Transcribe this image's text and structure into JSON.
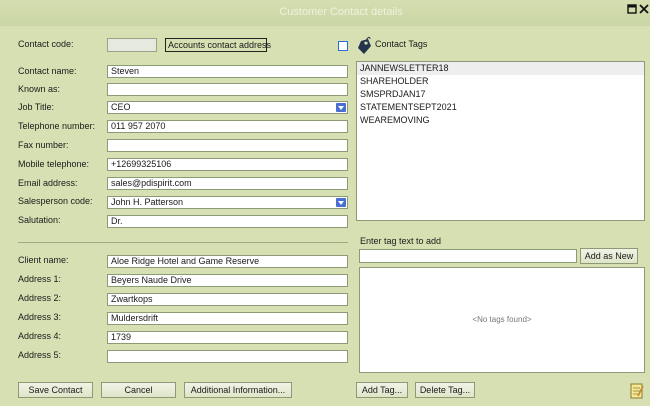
{
  "window": {
    "title": "Customer Contact details"
  },
  "contact_code": {
    "label": "Contact code:",
    "value": ""
  },
  "accounts_button": {
    "label": "Accounts contact address"
  },
  "contact_tags": {
    "label": "Contact Tags",
    "items": [
      "JANNEWSLETTER18",
      "SHAREHOLDER",
      "SMSPRDJAN17",
      "STATEMENTSEPT2021",
      "WEAREMOVING"
    ],
    "selected_index": 0
  },
  "fields": {
    "contact_name": {
      "label": "Contact name:",
      "value": "Steven"
    },
    "known_as": {
      "label": "Known as:",
      "value": ""
    },
    "job_title": {
      "label": "Job Title:",
      "value": "CEO"
    },
    "telephone": {
      "label": "Telephone number:",
      "value": "011 957 2070"
    },
    "fax": {
      "label": "Fax number:",
      "value": ""
    },
    "mobile": {
      "label": "Mobile telephone:",
      "value": "+12699325106"
    },
    "email": {
      "label": "Email address:",
      "value": "sales@pdispirit.com"
    },
    "salesperson": {
      "label": "Salesperson code:",
      "value": "John H. Patterson"
    },
    "salutation": {
      "label": "Salutation:",
      "value": "Dr."
    },
    "client_name": {
      "label": "Client name:",
      "value": "Aloe Ridge Hotel and Game Reserve"
    },
    "address1": {
      "label": "Address 1:",
      "value": "Beyers Naude Drive"
    },
    "address2": {
      "label": "Address 2:",
      "value": "Zwartkops"
    },
    "address3": {
      "label": "Address 3:",
      "value": "Muldersdrift"
    },
    "address4": {
      "label": "Address 4:",
      "value": "1739"
    },
    "address5": {
      "label": "Address 5:",
      "value": ""
    }
  },
  "tag_entry": {
    "label": "Enter tag text to add",
    "value": "",
    "add_label": "Add as New"
  },
  "no_tags": "<No tags found>",
  "buttons": {
    "save": "Save Contact",
    "cancel": "Cancel",
    "additional": "Additional Information...",
    "add_tag": "Add Tag...",
    "delete_tag": "Delete Tag..."
  }
}
